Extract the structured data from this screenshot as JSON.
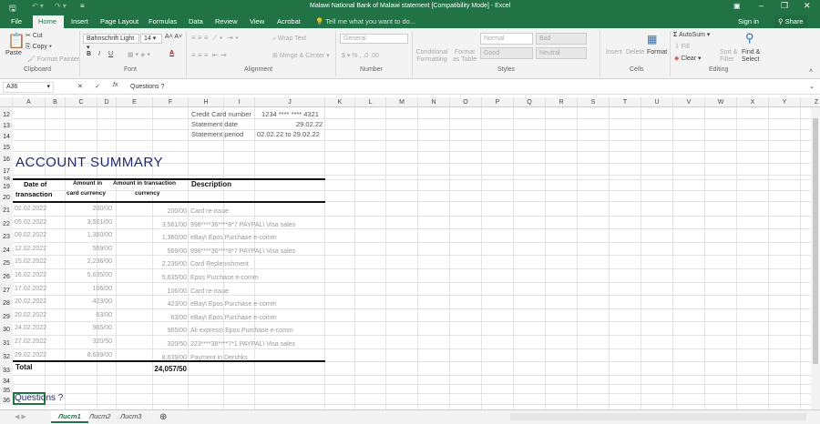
{
  "window": {
    "title": "Malawi National Bank of Malawi statement  [Compatibility Mode] - Excel",
    "sign_in": "Sign in",
    "share": "Share"
  },
  "ribbon_tabs": [
    "File",
    "Home",
    "Insert",
    "Page Layout",
    "Formulas",
    "Data",
    "Review",
    "View",
    "Acrobat"
  ],
  "tell_me": "Tell me what you want to do...",
  "clipboard": {
    "paste": "Paste",
    "cut": "Cut",
    "copy": "Copy",
    "format_painter": "Format Painter",
    "group": "Clipboard"
  },
  "font": {
    "name": "Bahnschrift Light",
    "size": "14",
    "bold": "B",
    "italic": "I",
    "underline": "U",
    "group": "Font"
  },
  "alignment": {
    "wrap": "Wrap Text",
    "merge": "Merge & Center",
    "group": "Alignment"
  },
  "number": {
    "format": "General",
    "group": "Number"
  },
  "styles": {
    "conditional": "Conditional Formatting",
    "format_table": "Format as Table",
    "normal": "Normal",
    "bad": "Bad",
    "good": "Good",
    "neutral": "Neutral",
    "group": "Styles"
  },
  "cells": {
    "insert": "Insert",
    "delete": "Delete",
    "format": "Format",
    "group": "Cells"
  },
  "editing": {
    "autosum": "AutoSum",
    "fill": "Fill",
    "clear": "Clear",
    "sort": "Sort & Filter",
    "find": "Find & Select",
    "group": "Editing"
  },
  "formula_bar": {
    "name_box": "A36",
    "value": "Questions ?"
  },
  "columns": [
    "A",
    "B",
    "C",
    "D",
    "E",
    "F",
    "H",
    "I",
    "J",
    "K",
    "L",
    "M",
    "N",
    "O",
    "P",
    "Q",
    "R",
    "S",
    "T",
    "U",
    "V",
    "W",
    "X",
    "Y",
    "Z"
  ],
  "info": {
    "card_label": "Credit Card number",
    "card_value": "1234 **** **** 4321",
    "date_label": "Statement date",
    "date_value": "29.02.22",
    "period_label": "Statement period",
    "period_value": "02.02.22 to 29.02.22"
  },
  "summary_title": "ACCOUNT SUMMARY",
  "headers": {
    "date1": "Date of",
    "date2": "transaction",
    "card1": "Amount in",
    "card2": "card currency",
    "trans1": "Amount in transaction",
    "trans2": "currency",
    "desc": "Description"
  },
  "transactions": [
    {
      "row": "21",
      "date": "02.02.2022",
      "card": "200/00",
      "trans": "200/00",
      "desc": "Card re-issue"
    },
    {
      "row": "22",
      "date": "05.02.2022",
      "card": "3,561/00",
      "trans": "3,561/00",
      "desc": "998****36****8*7 PAYPAL\\ Visa sales"
    },
    {
      "row": "23",
      "date": "09.02.2022",
      "card": "1,360/00",
      "trans": "1,360/00",
      "desc": "eBay\\ Epos Purchase e-comm"
    },
    {
      "row": "24",
      "date": "12.02.2022",
      "card": "569/00",
      "trans": "569/00",
      "desc": "998****36****8*7 PAYPAL\\ Visa sales"
    },
    {
      "row": "25",
      "date": "15.02.2022",
      "card": "2,236/00",
      "trans": "2,236/00",
      "desc": "Card Replenishment"
    },
    {
      "row": "26",
      "date": "16.02.2022",
      "card": "5,635/00",
      "trans": "5,635/00",
      "desc": "Epos Purchase e-comm"
    },
    {
      "row": "27",
      "date": "17.02.2022",
      "card": "106/00",
      "trans": "106/00",
      "desc": "Card re-issue"
    },
    {
      "row": "28",
      "date": "20.02.2022",
      "card": "423/00",
      "trans": "423/00",
      "desc": "eBay\\ Epos Purchase e-comm"
    },
    {
      "row": "29",
      "date": "20.02.2022",
      "card": "63/00",
      "trans": "63/00",
      "desc": "eBay\\ Epos Purchase e-comm"
    },
    {
      "row": "30",
      "date": "24.02.2022",
      "card": "965/00",
      "trans": "965/00",
      "desc": "Ali express\\ Epos Purchase e-comm"
    },
    {
      "row": "31",
      "date": "27.02.2022",
      "card": "320/50",
      "trans": "320/50",
      "desc": "223****38****7*1 PAYPAL\\ Visa sales"
    },
    {
      "row": "32",
      "date": "29.02.2022",
      "card": "8,639/00",
      "trans": "8,639/00",
      "desc": "Payment in Dershks"
    }
  ],
  "total": {
    "label": "Total",
    "value": "24,057/50"
  },
  "questions": "Questions ?",
  "row_numbers": {
    "r12": "12",
    "r13": "13",
    "r14": "14",
    "r15": "15",
    "r16": "16",
    "r17": "17",
    "r18": "18",
    "r19": "19",
    "r20": "20",
    "r33": "33",
    "r34": "34",
    "r35": "35",
    "r36": "36"
  },
  "sheets": [
    "Лист1",
    "Лист2",
    "Лист3"
  ],
  "colors": {
    "excel_green": "#217346",
    "title_blue": "#1f2a6e"
  }
}
